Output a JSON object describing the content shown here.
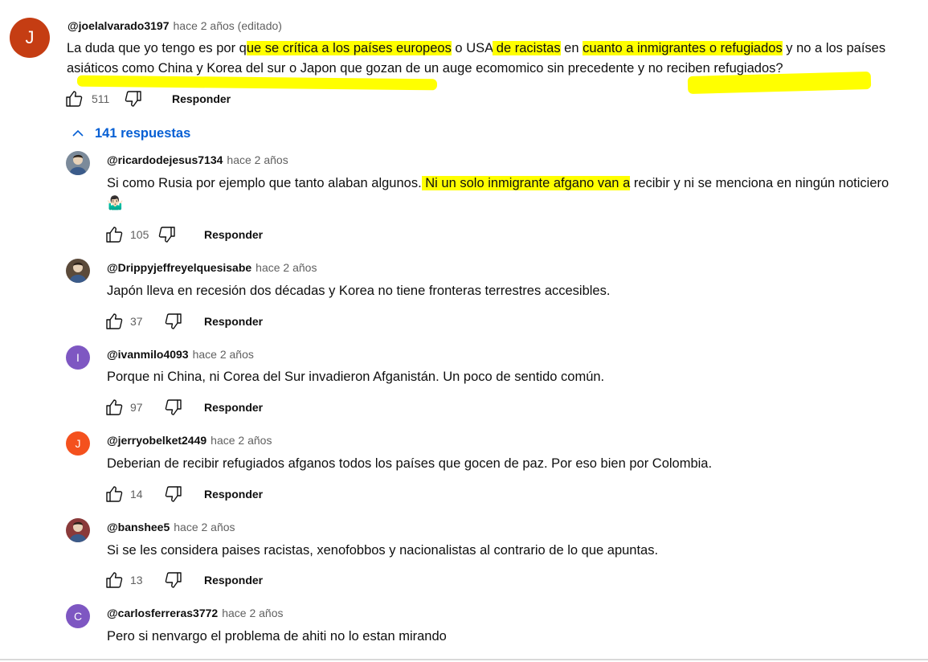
{
  "colors": {
    "highlight": "#ffff00",
    "link": "#065fd4",
    "meta_text": "#606060"
  },
  "top_comment": {
    "avatar_letter": "J",
    "avatar_color": "#c53d13",
    "author": "@joelalvarado3197",
    "time": "hace 2 años (editado)",
    "text_segments": [
      {
        "t": "La duda que yo tengo es por q",
        "hl": false
      },
      {
        "t": "ue se crítica a los países europeos",
        "hl": true
      },
      {
        "t": " o USA",
        "hl": false
      },
      {
        "t": " de racistas",
        "hl": true
      },
      {
        "t": " en ",
        "hl": false
      },
      {
        "t": "cuanto a inmigrantes o refugiados",
        "hl": true
      },
      {
        "t": " y no a los países asiáticos como China y Korea del sur o Japon que gozan de un auge ecomomico  sin precedente y no reciben refugiados?",
        "hl": false
      }
    ],
    "likes": "511",
    "reply_label": "Responder"
  },
  "replies_toggle": {
    "icon": "chevron-up-icon",
    "label": "141 respuestas"
  },
  "replies": [
    {
      "author": "@ricardodejesus7134",
      "time": "hace 2 años",
      "avatar_type": "photo",
      "avatar_color": "#7b8a9a",
      "text_segments": [
        {
          "t": "Si como Rusia por ejemplo que tanto alaban algunos.",
          "hl": false
        },
        {
          "t": " Ni un solo inmigrante afgano van a",
          "hl": true
        },
        {
          "t": " recibir y ni se menciona en ningún noticiero 🤷🏻‍♂️",
          "hl": false
        }
      ],
      "likes": "105",
      "reply_label": "Responder"
    },
    {
      "author": "@Drippyjeffreyelquesisabe",
      "time": "hace 2 años",
      "avatar_type": "photo",
      "avatar_color": "#5b4a3a",
      "text_segments": [
        {
          "t": "Japón lleva en recesión dos décadas y Korea no tiene fronteras terrestres accesibles.",
          "hl": false
        }
      ],
      "likes": "37",
      "reply_label": "Responder"
    },
    {
      "author": "@ivanmilo4093",
      "time": "hace 2 años",
      "avatar_type": "letter",
      "avatar_letter": "I",
      "avatar_color": "#7e57c2",
      "text_segments": [
        {
          "t": "Porque ni China, ni Corea del Sur invadieron Afganistán. Un poco de sentido común.",
          "hl": false
        }
      ],
      "likes": "97",
      "reply_label": "Responder"
    },
    {
      "author": "@jerryobelket2449",
      "time": "hace 2 años",
      "avatar_type": "letter",
      "avatar_letter": "J",
      "avatar_color": "#f4511e",
      "text_segments": [
        {
          "t": "Deberian de recibir refugiados afganos todos los países que gocen de paz. Por eso bien por Colombia.",
          "hl": false
        }
      ],
      "likes": "14",
      "reply_label": "Responder"
    },
    {
      "author": "@banshee5",
      "time": "hace 2 años",
      "avatar_type": "photo",
      "avatar_color": "#8a3a3a",
      "text_segments": [
        {
          "t": "Si se les considera paises racistas, xenofobbos y nacionalistas al contrario de lo que apuntas.",
          "hl": false
        }
      ],
      "likes": "13",
      "reply_label": "Responder"
    },
    {
      "author": "@carlosferreras3772",
      "time": "hace 2 años",
      "avatar_type": "letter",
      "avatar_letter": "C",
      "avatar_color": "#7e57c2",
      "text_segments": [
        {
          "t": "Pero si nenvargo el problema de ahiti no lo estan mirando",
          "hl": false
        }
      ]
    }
  ]
}
